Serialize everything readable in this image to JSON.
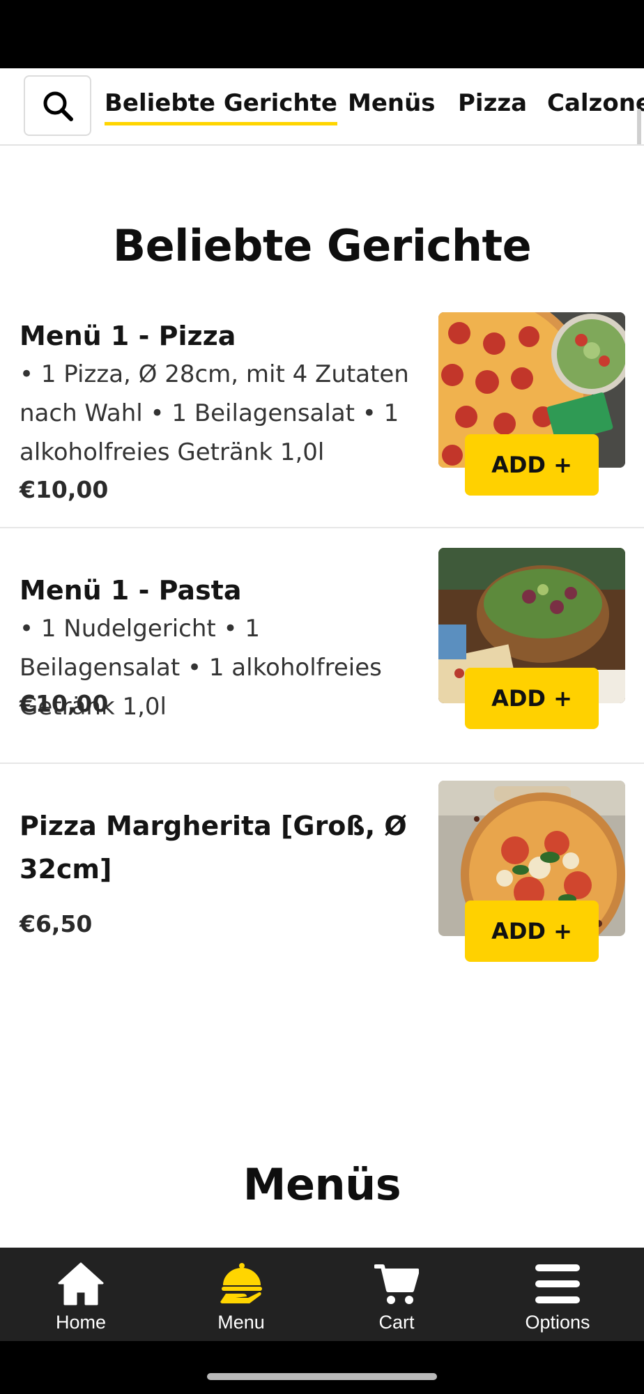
{
  "nav": {
    "tabs": [
      {
        "label": "Beliebte Gerichte",
        "active": true
      },
      {
        "label": "Menüs"
      },
      {
        "label": "Pizza"
      },
      {
        "label": "Calzone"
      }
    ]
  },
  "sections": [
    {
      "title": "Beliebte Gerichte",
      "items": [
        {
          "name": "Menü 1 - Pizza",
          "description": "• 1 Pizza, Ø 28cm, mit 4 Zutaten nach Wahl • 1 Beilagensalat • 1 alkoholfreies Getränk 1,0l",
          "price": "€10,00",
          "add_label": "ADD +",
          "image_icon": "pizza-salad-photo"
        },
        {
          "name": "Menü 1 - Pasta",
          "description": "• 1 Nudelgericht • 1 Beilagensalat • 1 alkoholfreies Getränk 1,0l",
          "price": "€10,00",
          "add_label": "ADD +",
          "image_icon": "salad-bowl-photo"
        },
        {
          "name": "Pizza Margherita [Groß, Ø 32cm]",
          "price": "€6,50",
          "add_label": "ADD +",
          "image_icon": "margherita-photo"
        }
      ]
    },
    {
      "title": "Menüs"
    }
  ],
  "bottom_nav": {
    "items": [
      {
        "label": "Home",
        "icon": "home-icon"
      },
      {
        "label": "Menu",
        "icon": "menu-icon",
        "active": true
      },
      {
        "label": "Cart",
        "icon": "cart-icon"
      },
      {
        "label": "Options",
        "icon": "options-icon"
      }
    ]
  },
  "colors": {
    "accent": "#ffd100",
    "tab_bar": "#222222",
    "text": "#141414"
  }
}
